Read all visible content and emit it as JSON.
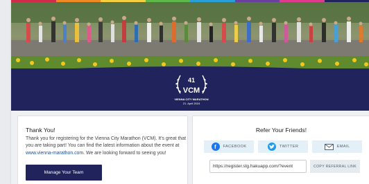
{
  "colors": {
    "navy": "#20235c",
    "stripe": [
      "#d22a4a",
      "#f08a24",
      "#f4d03f",
      "#5fb84a",
      "#2a9fd6",
      "#6a3fa0",
      "#e03a8c",
      "#20235c"
    ],
    "share_bg": "#e4f0f8",
    "facebook": "#1877f2",
    "twitter": "#1d9bf0"
  },
  "banner": {
    "logo": {
      "edition": "41",
      "abbr": "VCM",
      "name": "VIENNA CITY MARATHON",
      "date": "21. April 2024"
    }
  },
  "thanks": {
    "title": "Thank You!",
    "body_text": "Thank you for registering for the Vienna City Marathon (VCM). It's great that you are taking part! You can find the latest information about the event at",
    "link_text": "www.vienna-marathon.com",
    "body_tail": ". We are looking forward to seeing you!",
    "button": "Manage Your Team"
  },
  "refer": {
    "title": "Refer Your Friends!",
    "facebook": {
      "label": "FACEBOOK",
      "icon": "facebook-icon"
    },
    "twitter": {
      "label": "TWITTER",
      "icon": "twitter-icon"
    },
    "email": {
      "label": "EMAIL",
      "icon": "envelope-icon"
    },
    "url_value": "https://register.stg.hakuapp.com/?event",
    "copy_button": "COPY REFERRAL LINK"
  }
}
